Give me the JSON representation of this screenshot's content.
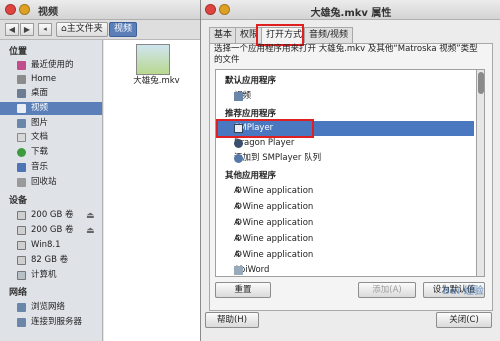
{
  "file_manager": {
    "title": "视频",
    "breadcrumb": [
      "主文件夹",
      "视频"
    ],
    "places_header": "位置",
    "places": [
      {
        "label": "最近使用的",
        "icon": "clock-icon"
      },
      {
        "label": "Home",
        "icon": "home-icon"
      },
      {
        "label": "桌面",
        "icon": "desktop-icon"
      },
      {
        "label": "视频",
        "icon": "video-icon",
        "selected": true
      },
      {
        "label": "图片",
        "icon": "pictures-icon"
      },
      {
        "label": "文档",
        "icon": "documents-icon"
      },
      {
        "label": "下载",
        "icon": "download-icon"
      },
      {
        "label": "音乐",
        "icon": "music-icon"
      },
      {
        "label": "回收站",
        "icon": "trash-icon"
      }
    ],
    "devices_header": "设备",
    "devices": [
      {
        "label": "200 GB 卷",
        "eject": true
      },
      {
        "label": "200 GB 卷",
        "eject": true
      },
      {
        "label": "Win8.1",
        "eject": false
      },
      {
        "label": "82 GB 卷",
        "eject": false
      },
      {
        "label": "计算机",
        "eject": false
      }
    ],
    "network_header": "网络",
    "network": [
      {
        "label": "浏览网络"
      },
      {
        "label": "连接到服务器"
      }
    ],
    "file": {
      "name": "大雄兔.mkv",
      "icon": "video-thumbnail-icon"
    }
  },
  "dialog": {
    "title": "大雄兔.mkv 属性",
    "tabs": [
      "基本",
      "权限",
      "打开方式",
      "音频/视频"
    ],
    "active_tab": "打开方式",
    "description": "选择一个应用程序用来打开 大雄兔.mkv 及其他“Matroska 视频”类型的文件",
    "default_header": "默认应用程序",
    "default_apps": [
      {
        "label": "视频",
        "icon": "video-app-icon"
      }
    ],
    "recommended_header": "推荐应用程序",
    "recommended_apps": [
      {
        "label": "SMPlayer",
        "icon": "smplayer-icon",
        "selected": true
      },
      {
        "label": "Dragon Player",
        "icon": "dragon-player-icon"
      },
      {
        "label": "添加到 SMPlayer 队列",
        "icon": "smplayer-queue-icon"
      }
    ],
    "other_header": "其他应用程序",
    "other_apps": [
      {
        "label": "A Wine application",
        "icon": "wine-gear-icon"
      },
      {
        "label": "A Wine application",
        "icon": "wine-gear-icon"
      },
      {
        "label": "A Wine application",
        "icon": "wine-gear-icon"
      },
      {
        "label": "A Wine application",
        "icon": "wine-gear-icon"
      },
      {
        "label": "A Wine application",
        "icon": "wine-gear-icon"
      },
      {
        "label": "AbiWord",
        "icon": "abiword-icon"
      }
    ],
    "buttons": {
      "reset": "重置",
      "add": "添加(A)",
      "set_default": "设为默认值",
      "help": "帮助(H)",
      "close": "关闭(C)"
    },
    "highlight_color": "#e02020",
    "selection_color": "#4a78c0"
  },
  "watermark": "Bai 经验"
}
